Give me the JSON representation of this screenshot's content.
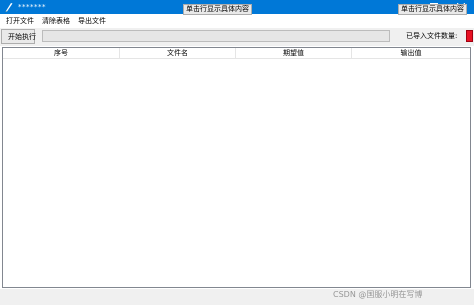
{
  "window": {
    "title": "*******",
    "colors": {
      "titlebar": "#0078d7",
      "close_indicator": "#e81123"
    }
  },
  "menu": {
    "items": [
      {
        "label": "打开文件"
      },
      {
        "label": "清除表格"
      },
      {
        "label": "导出文件"
      }
    ]
  },
  "toolbar": {
    "start_label": "开始执行",
    "progress": 0,
    "count_label": "已导入文件数量:"
  },
  "table": {
    "columns": [
      "序号",
      "文件名",
      "期望值",
      "输出值"
    ],
    "rows": []
  },
  "footer": {
    "detail_button_label": "单击行显示具体内容",
    "detail_button_label_2": "单击行显示具体内容",
    "watermark": "CSDN @国服小明在写博"
  },
  "icons": [
    "app-icon",
    "minimize-icon",
    "maximize-icon",
    "close-icon"
  ]
}
